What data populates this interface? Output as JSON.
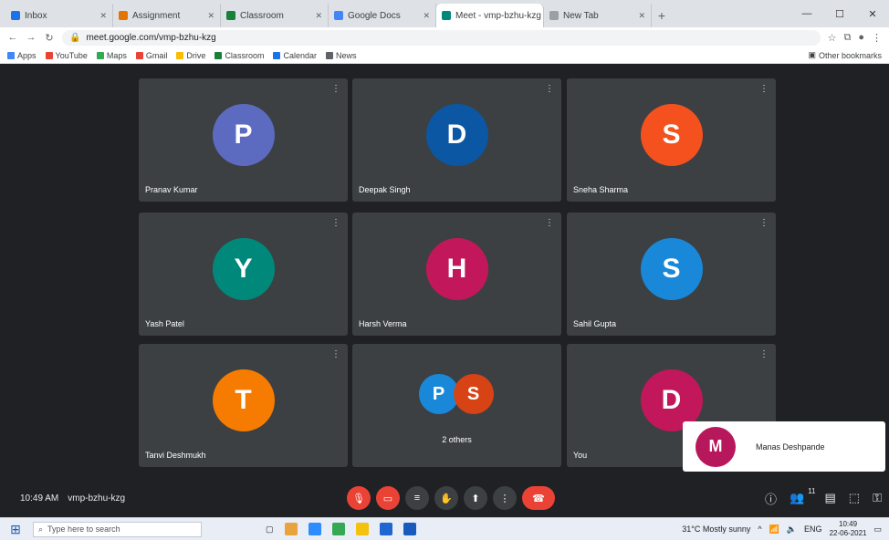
{
  "browser": {
    "tabs": [
      {
        "label": "Inbox",
        "color": "#1a73e8"
      },
      {
        "label": "Assignment",
        "color": "#e37400"
      },
      {
        "label": "Classroom",
        "color": "#188038"
      },
      {
        "label": "Google Docs",
        "color": "#4285f4"
      },
      {
        "label": "Meet - vmp-bzhu-kzg",
        "color": "#00897b",
        "active": true
      },
      {
        "label": "New Tab",
        "color": "#9aa0a6"
      }
    ],
    "url": "meet.google.com/vmp-bzhu-kzg",
    "bookmarks": [
      {
        "label": "Apps",
        "color": "#4285f4"
      },
      {
        "label": "YouTube",
        "color": "#ea4335"
      },
      {
        "label": "Maps",
        "color": "#34a853"
      },
      {
        "label": "Gmail",
        "color": "#ea4335"
      },
      {
        "label": "Drive",
        "color": "#fbbc04"
      },
      {
        "label": "Classroom",
        "color": "#188038"
      },
      {
        "label": "Calendar",
        "color": "#1a73e8"
      },
      {
        "label": "News",
        "color": "#5f6368"
      }
    ],
    "bookmarks_other": "Other bookmarks"
  },
  "participants": [
    {
      "initial": "P",
      "name": "Pranav Kumar",
      "color": "#5c6bc0"
    },
    {
      "initial": "D",
      "name": "Deepak Singh",
      "color": "#0b57a4"
    },
    {
      "initial": "S",
      "name": "Sneha Sharma",
      "color": "#f4511e"
    },
    {
      "initial": "Y",
      "name": "Yash Patel",
      "color": "#00897b"
    },
    {
      "initial": "H",
      "name": "Harsh Verma",
      "color": "#c2185b"
    },
    {
      "initial": "S",
      "name": "Sahil Gupta",
      "color": "#1a88d8"
    },
    {
      "initial": "T",
      "name": "Tanvi Deshmukh",
      "color": "#f57c00"
    },
    {
      "initial": "D",
      "name": "You",
      "color": "#c2185b"
    }
  ],
  "group_tile": {
    "initials": [
      "P",
      "S"
    ],
    "colors": [
      "#1a88d8",
      "#d84315"
    ],
    "label": "2 others"
  },
  "self_view": {
    "initial": "M",
    "name": "Manas Deshpande"
  },
  "controls": {
    "time": "10:49 AM",
    "meeting_code": "vmp-bzhu-kzg",
    "buttons": [
      "mic-off",
      "cam-off",
      "cc",
      "raise-hand",
      "present",
      "more"
    ],
    "leave": "leave"
  },
  "taskbar": {
    "search_placeholder": "Type here to search",
    "weather": "31°C Mostly sunny",
    "time": "10:49",
    "date": "22-06-2021",
    "lang": "ENG"
  }
}
